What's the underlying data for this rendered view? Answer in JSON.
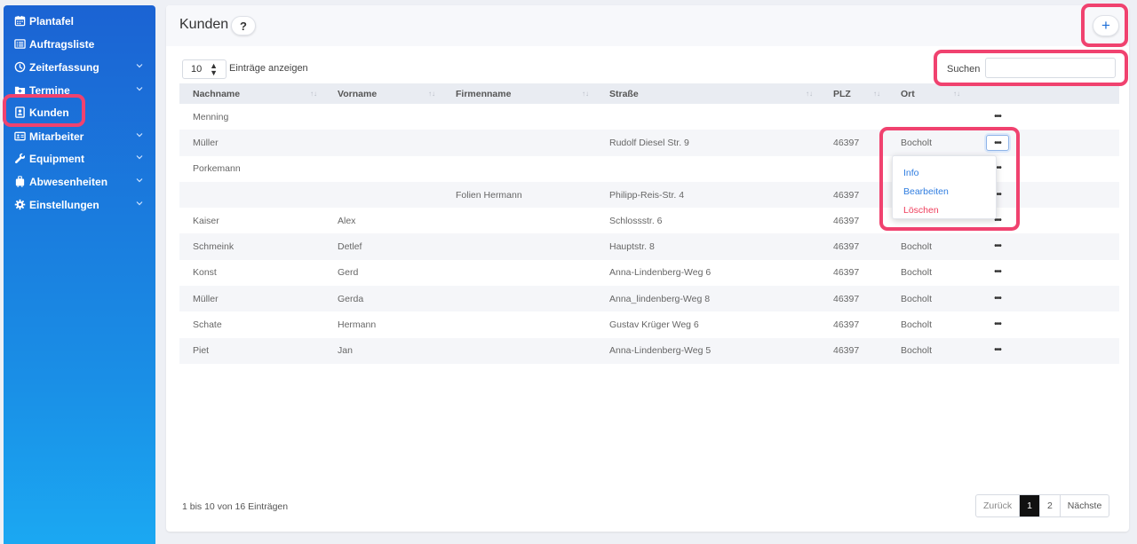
{
  "sidebar": {
    "items": [
      {
        "label": "Plantafel",
        "icon": "calendar-icon",
        "chevron": false
      },
      {
        "label": "Auftragsliste",
        "icon": "list-icon",
        "chevron": false
      },
      {
        "label": "Zeiterfassung",
        "icon": "clock-icon",
        "chevron": true
      },
      {
        "label": "Termine",
        "icon": "calendar-plus-icon",
        "chevron": true
      },
      {
        "label": "Kunden",
        "icon": "contact-card-icon",
        "chevron": false
      },
      {
        "label": "Mitarbeiter",
        "icon": "id-card-icon",
        "chevron": true
      },
      {
        "label": "Equipment",
        "icon": "wrench-icon",
        "chevron": true
      },
      {
        "label": "Abwesenheiten",
        "icon": "suitcase-icon",
        "chevron": true
      },
      {
        "label": "Einstellungen",
        "icon": "gear-icon",
        "chevron": true
      }
    ]
  },
  "header": {
    "title": "Kunden",
    "help_label": "?",
    "add_label": "+"
  },
  "length": {
    "value": "10",
    "label": "Einträge anzeigen"
  },
  "search": {
    "label": "Suchen",
    "value": ""
  },
  "table": {
    "columns": [
      "Nachname",
      "Vorname",
      "Firmenname",
      "Straße",
      "PLZ",
      "Ort"
    ],
    "sort_glyph": "↑↓",
    "action_glyph": "•••",
    "rows": [
      [
        "Menning",
        "",
        "",
        "",
        "",
        ""
      ],
      [
        "Müller",
        "",
        "",
        "Rudolf Diesel Str. 9",
        "46397",
        "Bocholt"
      ],
      [
        "Porkemann",
        "",
        "",
        "",
        "",
        ""
      ],
      [
        "",
        "",
        "Folien Hermann",
        "Philipp-Reis-Str. 4",
        "46397",
        ""
      ],
      [
        "Kaiser",
        "Alex",
        "",
        "Schlossstr. 6",
        "46397",
        ""
      ],
      [
        "Schmeink",
        "Detlef",
        "",
        "Hauptstr. 8",
        "46397",
        "Bocholt"
      ],
      [
        "Konst",
        "Gerd",
        "",
        "Anna-Lindenberg-Weg 6",
        "46397",
        "Bocholt"
      ],
      [
        "Müller",
        "Gerda",
        "",
        "Anna_lindenberg-Weg 8",
        "46397",
        "Bocholt"
      ],
      [
        "Schate",
        "Hermann",
        "",
        "Gustav Krüger Weg 6",
        "46397",
        "Bocholt"
      ],
      [
        "Piet",
        "Jan",
        "",
        "Anna-Lindenberg-Weg 5",
        "46397",
        "Bocholt"
      ]
    ]
  },
  "dropdown": {
    "items": [
      {
        "label": "Info",
        "color": "#2f7de0"
      },
      {
        "label": "Bearbeiten",
        "color": "#2f7de0"
      },
      {
        "label": "Löschen",
        "color": "#ef3e5c"
      }
    ]
  },
  "footer": {
    "info": "1 bis 10 von 16 Einträgen",
    "prev": "Zurück",
    "pages": [
      "1",
      "2"
    ],
    "next": "Nächste"
  },
  "colors": {
    "accent": "#1d6fd8",
    "highlight": "#f0426f",
    "sidebar_top": "#1b63d3",
    "sidebar_bottom": "#1ba8f2"
  }
}
